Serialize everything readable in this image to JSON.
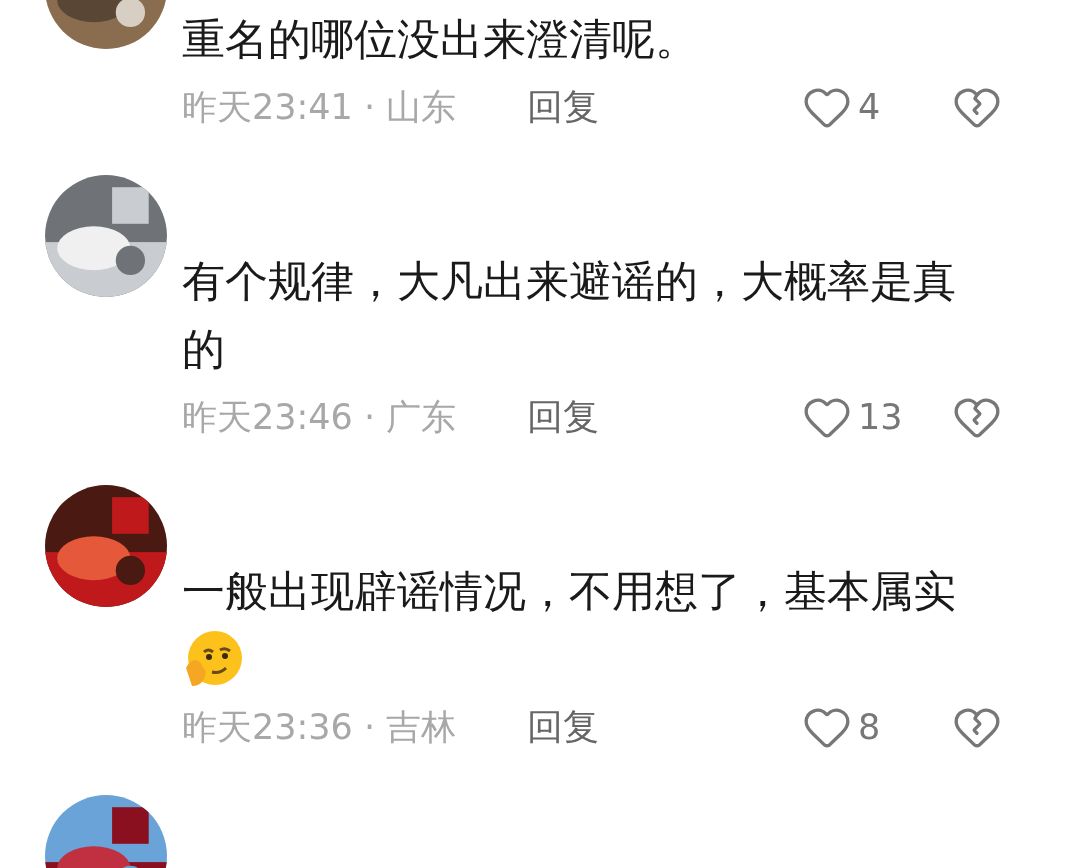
{
  "comments": [
    {
      "text": "重名的哪位没出来澄清呢。",
      "time": "昨天23:41",
      "separator": "·",
      "location": "山东",
      "reply": "回复",
      "likes": "4",
      "liked": false,
      "avatar": {
        "kind": "picture"
      }
    },
    {
      "text": "有个规律，大凡出来避谣的，大概率是真的",
      "time": "昨天23:46",
      "separator": "·",
      "location": "广东",
      "reply": "回复",
      "likes": "13",
      "liked": false,
      "avatar": {
        "kind": "picture"
      }
    },
    {
      "text": "一般出现辟谣情况，不用想了，基本属实",
      "emoji": true,
      "time": "昨天23:36",
      "separator": "·",
      "location": "吉林",
      "reply": "回复",
      "likes": "8",
      "liked": false,
      "avatar": {
        "kind": "picture"
      }
    },
    {
      "avatar": {
        "kind": "picture"
      }
    }
  ]
}
